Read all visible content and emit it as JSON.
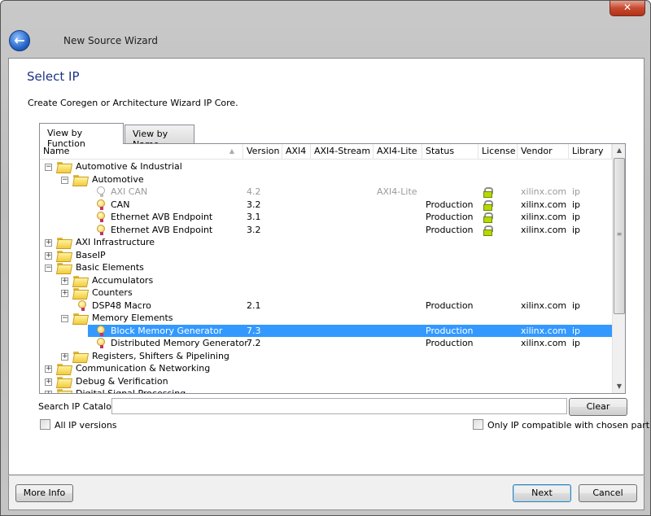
{
  "window": {
    "title": "New Source Wizard",
    "close_icon": "close-icon",
    "back_icon": "back-arrow-icon"
  },
  "page": {
    "heading": "Select IP",
    "description": "Create Coregen or Architecture Wizard IP Core."
  },
  "tabs": [
    {
      "label": "View by Function",
      "active": true
    },
    {
      "label": "View by Name",
      "active": false
    }
  ],
  "columns": [
    "Name",
    "Version",
    "AXI4",
    "AXI4-Stream",
    "AXI4-Lite",
    "Status",
    "License",
    "Vendor",
    "Library"
  ],
  "sort": {
    "column": "Name",
    "direction": "ascending"
  },
  "rows": [
    {
      "name": "Automotive & Industrial",
      "level": 0,
      "type": "folder",
      "expanded": true
    },
    {
      "name": "Automotive",
      "level": 1,
      "type": "folder",
      "expanded": true
    },
    {
      "name": "AXI CAN",
      "level": 2,
      "type": "ip",
      "version": "4.2",
      "axi4": "",
      "axi4stream": "",
      "axi4lite": "AXI4-Lite",
      "status": "",
      "license": true,
      "vendor": "xilinx.com",
      "library": "ip",
      "disabled": true
    },
    {
      "name": "CAN",
      "level": 2,
      "type": "ip",
      "version": "3.2",
      "axi4": "",
      "axi4stream": "",
      "axi4lite": "",
      "status": "Production",
      "license": true,
      "vendor": "xilinx.com",
      "library": "ip"
    },
    {
      "name": "Ethernet AVB Endpoint",
      "level": 2,
      "type": "ip",
      "version": "3.1",
      "axi4": "",
      "axi4stream": "",
      "axi4lite": "",
      "status": "Production",
      "license": true,
      "vendor": "xilinx.com",
      "library": "ip"
    },
    {
      "name": "Ethernet AVB Endpoint",
      "level": 2,
      "type": "ip",
      "version": "3.2",
      "axi4": "",
      "axi4stream": "",
      "axi4lite": "",
      "status": "Production",
      "license": true,
      "vendor": "xilinx.com",
      "library": "ip"
    },
    {
      "name": "AXI Infrastructure",
      "level": 0,
      "type": "folder",
      "expanded": false
    },
    {
      "name": "BaseIP",
      "level": 0,
      "type": "folder",
      "expanded": false
    },
    {
      "name": "Basic Elements",
      "level": 0,
      "type": "folder",
      "expanded": true
    },
    {
      "name": "Accumulators",
      "level": 1,
      "type": "folder",
      "expanded": false
    },
    {
      "name": "Counters",
      "level": 1,
      "type": "folder",
      "expanded": false
    },
    {
      "name": "DSP48 Macro",
      "level": 1,
      "type": "ip",
      "version": "2.1",
      "axi4": "",
      "axi4stream": "",
      "axi4lite": "",
      "status": "Production",
      "license": false,
      "vendor": "xilinx.com",
      "library": "ip"
    },
    {
      "name": "Memory Elements",
      "level": 1,
      "type": "folder",
      "expanded": true
    },
    {
      "name": "Block Memory Generator",
      "level": 2,
      "type": "ip",
      "version": "7.3",
      "axi4": "",
      "axi4stream": "",
      "axi4lite": "",
      "status": "Production",
      "license": false,
      "vendor": "xilinx.com",
      "library": "ip",
      "selected": true
    },
    {
      "name": "Distributed Memory Generator",
      "level": 2,
      "type": "ip",
      "version": "7.2",
      "axi4": "",
      "axi4stream": "",
      "axi4lite": "",
      "status": "Production",
      "license": false,
      "vendor": "xilinx.com",
      "library": "ip"
    },
    {
      "name": "Registers, Shifters & Pipelining",
      "level": 1,
      "type": "folder",
      "expanded": false
    },
    {
      "name": "Communication & Networking",
      "level": 0,
      "type": "folder",
      "expanded": false
    },
    {
      "name": "Debug & Verification",
      "level": 0,
      "type": "folder",
      "expanded": false
    },
    {
      "name": "Digital Signal Processing",
      "level": 0,
      "type": "folder",
      "expanded": false
    }
  ],
  "search": {
    "label": "Search IP Catalog:",
    "value": "",
    "clear_label": "Clear"
  },
  "options": {
    "all_versions_label": "All IP versions",
    "all_versions_checked": false,
    "compatible_label": "Only IP compatible with chosen part",
    "compatible_checked": false
  },
  "footer": {
    "more_info": "More Info",
    "next": "Next",
    "cancel": "Cancel"
  },
  "colors": {
    "selection": "#3399ff",
    "heading": "#1e3287",
    "close": "#c74a30"
  }
}
